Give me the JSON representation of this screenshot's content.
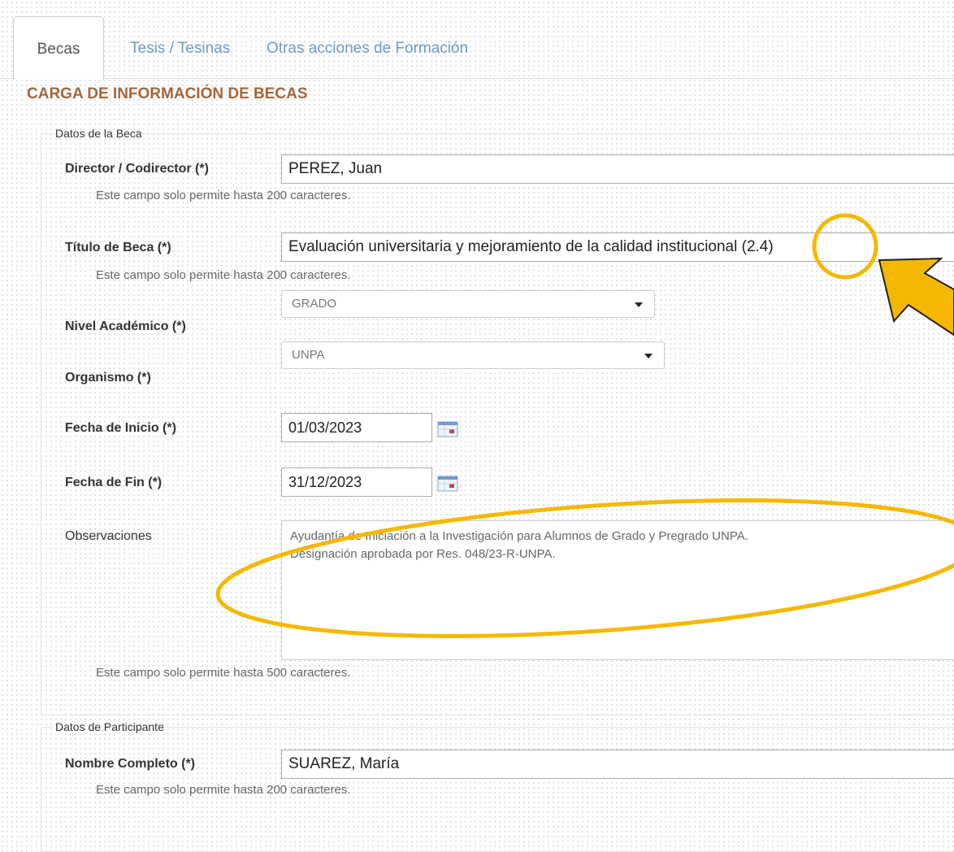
{
  "tabs": {
    "becas": "Becas",
    "tesis": "Tesis / Tesinas",
    "otras": "Otras acciones de Formación"
  },
  "section_title": "CARGA DE INFORMACIÓN DE BECAS",
  "beca": {
    "legend": "Datos de la Beca",
    "director": {
      "label": "Director / Codirector (*)",
      "value": "PEREZ, Juan",
      "hint": "Este campo solo permite hasta 200 caracteres."
    },
    "titulo": {
      "label": "Título de Beca (*)",
      "value": "Evaluación universitaria y mejoramiento de la calidad institucional (2.4)",
      "hint": "Este campo solo permite hasta 200 caracteres."
    },
    "nivel": {
      "label": "Nivel Académico (*)",
      "value": "GRADO"
    },
    "organismo": {
      "label": "Organismo (*)",
      "value": "UNPA"
    },
    "fecha_inicio": {
      "label": "Fecha de Inicio (*)",
      "value": "01/03/2023"
    },
    "fecha_fin": {
      "label": "Fecha de Fin (*)",
      "value": "31/12/2023"
    },
    "observaciones": {
      "label": "Observaciones",
      "value": "Ayudantía de Iniciación a la Investigación para Alumnos de Grado y Pregrado UNPA.\nDesignación aprobada por Res. 048/23-R-UNPA.",
      "hint": "Este campo solo permite hasta 500 caracteres."
    }
  },
  "participante": {
    "legend": "Datos de Participante",
    "nombre": {
      "label": "Nombre Completo (*)",
      "value": "SUAREZ, María",
      "hint": "Este campo solo permite hasta 200 caracteres."
    }
  },
  "annotations": {
    "highlight_color": "#f5b800"
  },
  "icons": {
    "calendar": "calendar-icon",
    "dropdown": "caret-down-icon"
  }
}
